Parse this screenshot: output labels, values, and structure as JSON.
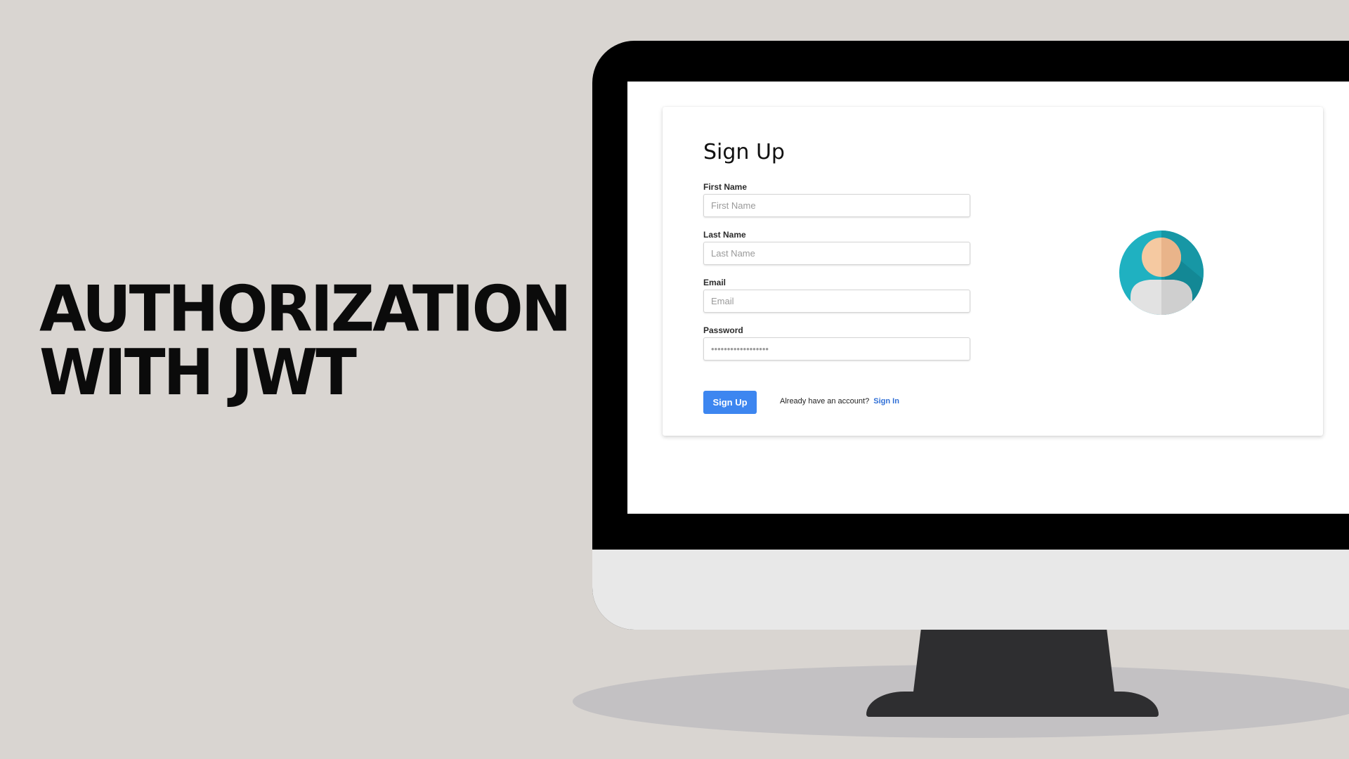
{
  "headline": {
    "line1": "AUTHORIZATION",
    "line2": "WITH JWT"
  },
  "signup_form": {
    "title": "Sign Up",
    "fields": [
      {
        "label": "First Name",
        "placeholder": "First Name",
        "value": ""
      },
      {
        "label": "Last Name",
        "placeholder": "Last Name",
        "value": ""
      },
      {
        "label": "Email",
        "placeholder": "Email",
        "value": ""
      },
      {
        "label": "Password",
        "placeholder": "••••••••••••••••••",
        "value": ""
      }
    ],
    "submit_label": "Sign Up",
    "signin_prompt": "Already have an account?",
    "signin_link": "Sign In"
  },
  "icons": {
    "avatar": "user-avatar-icon"
  },
  "colors": {
    "background": "#d9d5d1",
    "button": "#3d86f0",
    "link": "#2f6fd6",
    "avatar_circle": "#1fb1c1"
  }
}
